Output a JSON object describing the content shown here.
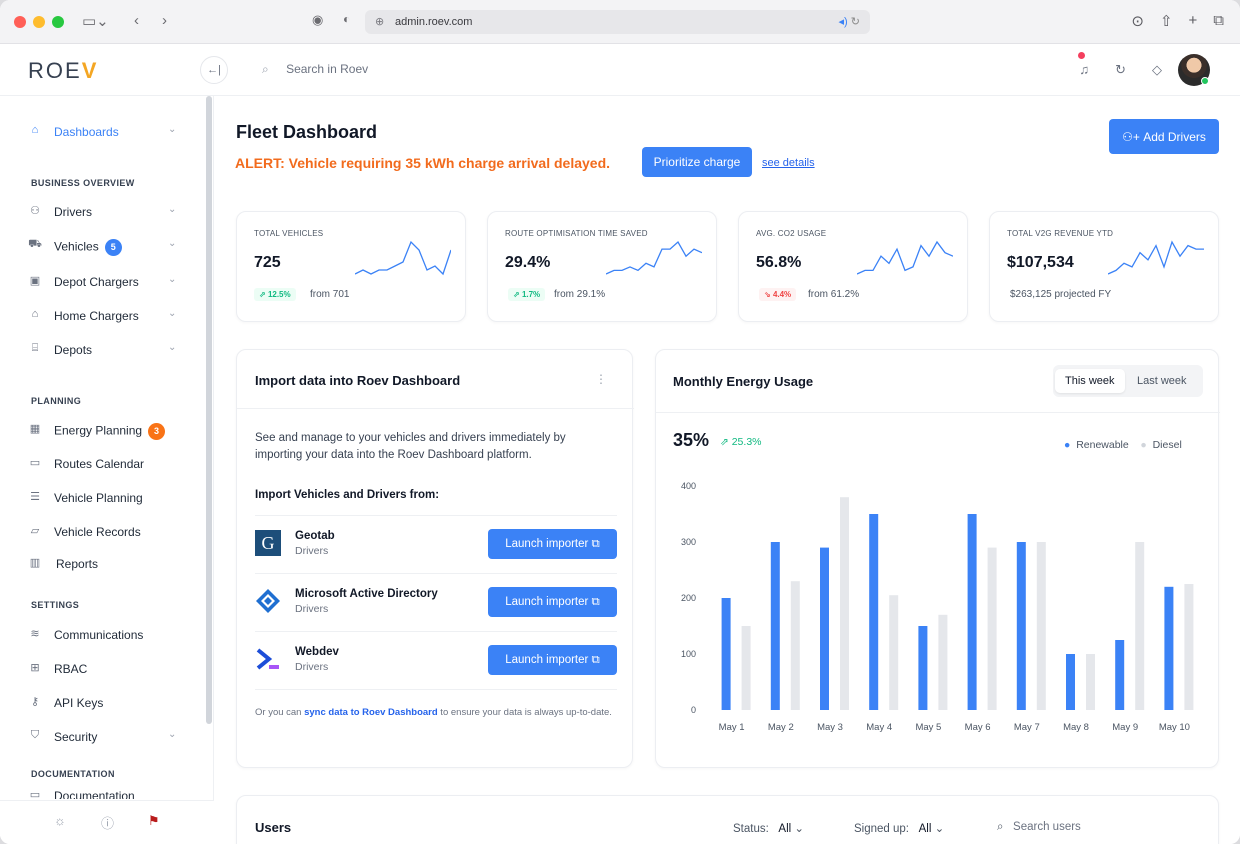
{
  "browser": {
    "url": "admin.roev.com"
  },
  "app": {
    "logo": "ROEV",
    "search_placeholder": "Search in Roev"
  },
  "sidebar": {
    "dashboards": "Dashboards",
    "sections": {
      "business": "BUSINESS OVERVIEW",
      "planning": "PLANNING",
      "settings": "SETTINGS",
      "documentation": "DOCUMENTATION"
    },
    "business_items": [
      "Drivers",
      "Vehicles",
      "Depot Chargers",
      "Home Chargers",
      "Depots"
    ],
    "vehicles_badge": "5",
    "planning_items": [
      "Energy Planning",
      "Routes Calendar",
      "Vehicle Planning",
      "Vehicle Records",
      "Reports"
    ],
    "energy_badge": "3",
    "settings_items": [
      "Communications",
      "RBAC",
      "API Keys",
      "Security"
    ],
    "doc_item": "Documentation"
  },
  "header": {
    "title": "Fleet Dashboard",
    "alert": "ALERT: Vehicle requiring 35 kWh charge arrival delayed.",
    "prioritize": "Prioritize charge",
    "details": "see details",
    "add_drivers": "Add Drivers"
  },
  "kpis": [
    {
      "title": "TOTAL VEHICLES",
      "value": "725",
      "change": "12.5%",
      "trend": "up",
      "from": "from 701",
      "spark": [
        6,
        7,
        6,
        7,
        7,
        8,
        9,
        14,
        12,
        7,
        8,
        6,
        12
      ]
    },
    {
      "title": "ROUTE OPTIMISATION TIME SAVED",
      "value": "29.4%",
      "change": "1.7%",
      "trend": "up",
      "from": "from 29.1%",
      "spark": [
        5,
        6,
        6,
        7,
        6,
        8,
        7,
        12,
        12,
        14,
        10,
        12,
        11
      ]
    },
    {
      "title": "AVG. CO2 USAGE",
      "value": "56.8%",
      "change": "4.4%",
      "trend": "down",
      "from": "from 61.2%",
      "spark": [
        5,
        6,
        6,
        10,
        8,
        12,
        6,
        7,
        13,
        10,
        14,
        11,
        10
      ]
    },
    {
      "title": "TOTAL V2G REVENUE YTD",
      "value": "$107,534",
      "change": "",
      "trend": "none",
      "from": "$263,125 projected FY",
      "spark": [
        5,
        6,
        8,
        7,
        11,
        9,
        13,
        7,
        14,
        10,
        13,
        12,
        12
      ]
    }
  ],
  "import_card": {
    "title": "Import data into Roev Dashboard",
    "description": "See and manage to your vehicles and drivers immediately by importing your data into the Roev Dashboard platform.",
    "subtitle": "Import Vehicles and Drivers from:",
    "sources": [
      {
        "name": "Geotab",
        "kind": "Drivers",
        "button": "Launch importer"
      },
      {
        "name": "Microsoft Active Directory",
        "kind": "Drivers",
        "button": "Launch importer"
      },
      {
        "name": "Webdev",
        "kind": "Drivers",
        "button": "Launch importer"
      }
    ],
    "footer_prefix": "Or you can ",
    "footer_link": "sync data to Roev Dashboard",
    "footer_suffix": " to ensure your data is always up-to-date."
  },
  "energy_card": {
    "title": "Monthly Energy Usage",
    "tabs": [
      "This week",
      "Last week"
    ],
    "active_tab": "This week",
    "big_value": "35%",
    "change": "25.3%"
  },
  "users_card": {
    "title": "Users",
    "status_label": "Status:",
    "status_value": "All",
    "signed_label": "Signed up:",
    "signed_value": "All",
    "search_placeholder": "Search users"
  },
  "chart_data": {
    "type": "bar",
    "categories": [
      "May 1",
      "May 2",
      "May 3",
      "May 4",
      "May 5",
      "May 6",
      "May 7",
      "May 8",
      "May 9",
      "May 10"
    ],
    "series": [
      {
        "name": "Renewable",
        "color": "#3b82f6",
        "values": [
          200,
          300,
          290,
          350,
          150,
          350,
          300,
          100,
          125,
          220
        ]
      },
      {
        "name": "Diesel",
        "color": "#e5e7eb",
        "values": [
          150,
          230,
          380,
          205,
          170,
          290,
          300,
          100,
          300,
          225
        ]
      }
    ],
    "ylim": [
      0,
      400
    ],
    "yticks": [
      0,
      100,
      200,
      300,
      400
    ],
    "legend": "top-right",
    "grid": false
  }
}
